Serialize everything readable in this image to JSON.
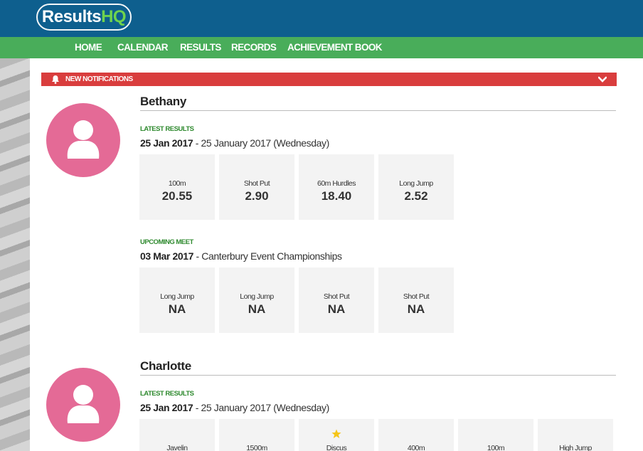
{
  "brand": {
    "logo_part1": "Results",
    "logo_part2": "HQ"
  },
  "nav": {
    "items": [
      "HOME",
      "CALENDAR",
      "RESULTS",
      "RECORDS",
      "ACHIEVEMENT BOOK"
    ]
  },
  "notifications": {
    "label": "NEW NOTIFICATIONS"
  },
  "colors": {
    "header": "#0e5f8e",
    "nav": "#49ad5a",
    "notification": "#d93d3d",
    "avatar": "#e46a96",
    "label_green": "#2f8a2f",
    "star": "#f5c518"
  },
  "athletes": [
    {
      "name": "Bethany",
      "latest": {
        "label": "LATEST RESULTS",
        "date": "25 Jan 2017",
        "detail": " - 25 January 2017 (Wednesday)",
        "events": [
          {
            "event": "100m",
            "value": "20.55"
          },
          {
            "event": "Shot Put",
            "value": "2.90"
          },
          {
            "event": "60m Hurdles",
            "value": "18.40"
          },
          {
            "event": "Long Jump",
            "value": "2.52"
          }
        ]
      },
      "upcoming": {
        "label": "UPCOMING MEET",
        "date": "03 Mar 2017",
        "detail": " - Canterbury Event Championships",
        "events": [
          {
            "event": "Long Jump",
            "value": "NA"
          },
          {
            "event": "Long Jump",
            "value": "NA"
          },
          {
            "event": "Shot Put",
            "value": "NA"
          },
          {
            "event": "Shot Put",
            "value": "NA"
          }
        ]
      }
    },
    {
      "name": "Charlotte",
      "latest": {
        "label": "LATEST RESULTS",
        "date": "25 Jan 2017",
        "detail": " - 25 January 2017 (Wednesday)",
        "events": [
          {
            "event": "Javelin"
          },
          {
            "event": "1500m"
          },
          {
            "event": "Discus",
            "icon": "star-icon"
          },
          {
            "event": "400m"
          },
          {
            "event": "100m"
          },
          {
            "event": "High Jump"
          }
        ]
      }
    }
  ]
}
